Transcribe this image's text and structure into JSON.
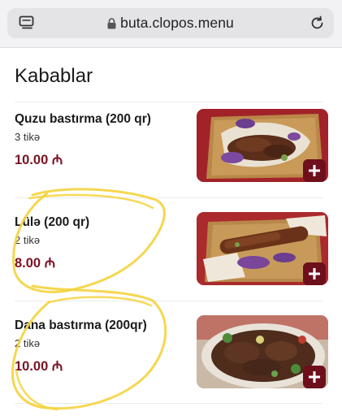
{
  "browser": {
    "url": "buta.clopos.menu"
  },
  "category": {
    "title": "Kabablar"
  },
  "menu": {
    "currency": "₼",
    "items": [
      {
        "name": "Quzu bastırma (200 qr)",
        "qty": "3 tikə",
        "price": "10.00 ₼",
        "image": "kebab-on-wooden-board-photo"
      },
      {
        "name": "Lülə (200 qr)",
        "qty": "2 tikə",
        "price": "8.00 ₼",
        "image": "lule-kebab-on-lavash-photo"
      },
      {
        "name": "Dana bastırma (200qr)",
        "qty": "2 tikə",
        "price": "10.00 ₼",
        "image": "beef-kebab-with-greens-photo"
      }
    ]
  },
  "colors": {
    "price": "#7a1222",
    "add_button": "#6e0f1c",
    "annotation": "#f4d33c"
  }
}
